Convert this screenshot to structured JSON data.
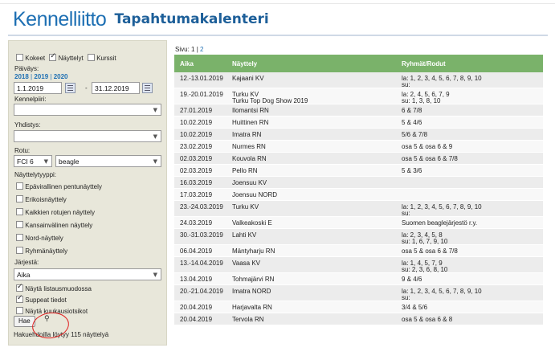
{
  "header": {
    "logo": "Kennelliitto",
    "subtitle": "Tapahtumakalenteri"
  },
  "filters": {
    "types": [
      {
        "label": "Kokeet",
        "checked": false
      },
      {
        "label": "Näyttelyt",
        "checked": true
      },
      {
        "label": "Kurssit",
        "checked": false
      }
    ],
    "date_label": "Päiväys:",
    "years": [
      "2018",
      "2019",
      "2020"
    ],
    "date_from": "1.1.2019",
    "date_to": "31.12.2019",
    "date_sep": "-",
    "kennelpiiri_label": "Kennelpiiri:",
    "kennelpiiri_value": "",
    "yhdistys_label": "Yhdistys:",
    "yhdistys_value": "",
    "rotu_label": "Rotu:",
    "fci_value": "FCI 6",
    "breed_value": "beagle",
    "nayttelytyyppi_label": "Näyttelytyyppi:",
    "show_types": [
      {
        "label": "Epävirallinen pentunäyttely",
        "checked": false
      },
      {
        "label": "Erikoisnäyttely",
        "checked": false
      },
      {
        "label": "Kaikkien rotujen näyttely",
        "checked": false
      },
      {
        "label": "Kansainvälinen näyttely",
        "checked": false
      },
      {
        "label": "Nord-näyttely",
        "checked": false
      },
      {
        "label": "Ryhmänäyttely",
        "checked": false
      }
    ],
    "sort_label": "Järjestä:",
    "sort_value": "Aika",
    "options": [
      {
        "label": "Näytä listausmuodossa",
        "checked": true
      },
      {
        "label": "Suppeat tiedot",
        "checked": true
      },
      {
        "label": "Näytä kuukausiotsikot",
        "checked": false
      }
    ],
    "search_button": "Hae",
    "result_text": "Hakuehdoilla löytyy 115 näyttelyä",
    "icons": {
      "pin": "pin-icon",
      "calendar": "calendar-icon",
      "dropdown": "chevron-down-icon"
    }
  },
  "pager": {
    "label": "Sivu:",
    "current": "1",
    "sep": "|",
    "next": "2"
  },
  "table": {
    "headers": [
      "Aika",
      "Näyttely",
      "Ryhmät/Rodut"
    ],
    "rows": [
      {
        "date": "12.-13.01.2019",
        "show": [
          "Kajaani KV"
        ],
        "groups": [
          "la: 1, 2, 3, 4, 5, 6, 7, 8, 9, 10",
          "su:"
        ]
      },
      {
        "date": "19.-20.01.2019",
        "show": [
          "Turku KV",
          "Turku Top Dog Show 2019"
        ],
        "groups": [
          "la: 2, 4, 5, 6, 7, 9",
          "su: 1, 3, 8, 10"
        ]
      },
      {
        "date": "27.01.2019",
        "show": [
          "Ilomantsi RN"
        ],
        "groups": [
          "6 & 7/8"
        ]
      },
      {
        "date": "10.02.2019",
        "show": [
          "Huittinen RN"
        ],
        "groups": [
          "5 & 4/6"
        ]
      },
      {
        "date": "10.02.2019",
        "show": [
          "Imatra RN"
        ],
        "groups": [
          "5/6 & 7/8"
        ]
      },
      {
        "date": "23.02.2019",
        "show": [
          "Nurmes RN"
        ],
        "groups": [
          "osa 5 & osa 6 & 9"
        ]
      },
      {
        "date": "02.03.2019",
        "show": [
          "Kouvola RN"
        ],
        "groups": [
          "osa 5 & osa 6 & 7/8"
        ]
      },
      {
        "date": "02.03.2019",
        "show": [
          "Pello RN"
        ],
        "groups": [
          "5 & 3/6"
        ]
      },
      {
        "date": "16.03.2019",
        "show": [
          "Joensuu KV"
        ],
        "groups": [
          ""
        ]
      },
      {
        "date": "17.03.2019",
        "show": [
          "Joensuu NORD"
        ],
        "groups": [
          ""
        ]
      },
      {
        "date": "23.-24.03.2019",
        "show": [
          "Turku KV"
        ],
        "groups": [
          "la: 1, 2, 3, 4, 5, 6, 7, 8, 9, 10",
          "su:"
        ]
      },
      {
        "date": "24.03.2019",
        "show": [
          "Valkeakoski E"
        ],
        "groups": [
          "Suomen beaglejärjestö r.y."
        ]
      },
      {
        "date": "30.-31.03.2019",
        "show": [
          "Lahti KV"
        ],
        "groups": [
          "la: 2, 3, 4, 5, 8",
          "su: 1, 6, 7, 9, 10"
        ]
      },
      {
        "date": "06.04.2019",
        "show": [
          "Mäntyharju RN"
        ],
        "groups": [
          "osa 5 & osa 6 & 7/8"
        ]
      },
      {
        "date": "13.-14.04.2019",
        "show": [
          "Vaasa KV"
        ],
        "groups": [
          "la: 1, 4, 5, 7, 9",
          "su: 2, 3, 6, 8, 10"
        ]
      },
      {
        "date": "13.04.2019",
        "show": [
          "Tohmajärvi RN"
        ],
        "groups": [
          "9 & 4/6"
        ]
      },
      {
        "date": "20.-21.04.2019",
        "show": [
          "Imatra NORD"
        ],
        "groups": [
          "la: 1, 2, 3, 4, 5, 6, 7, 8, 9, 10",
          "su:"
        ]
      },
      {
        "date": "20.04.2019",
        "show": [
          "Harjavalta RN"
        ],
        "groups": [
          "3/4 & 5/6"
        ]
      },
      {
        "date": "20.04.2019",
        "show": [
          "Tervola RN"
        ],
        "groups": [
          "osa 5 & osa 6 & 8"
        ]
      }
    ]
  }
}
